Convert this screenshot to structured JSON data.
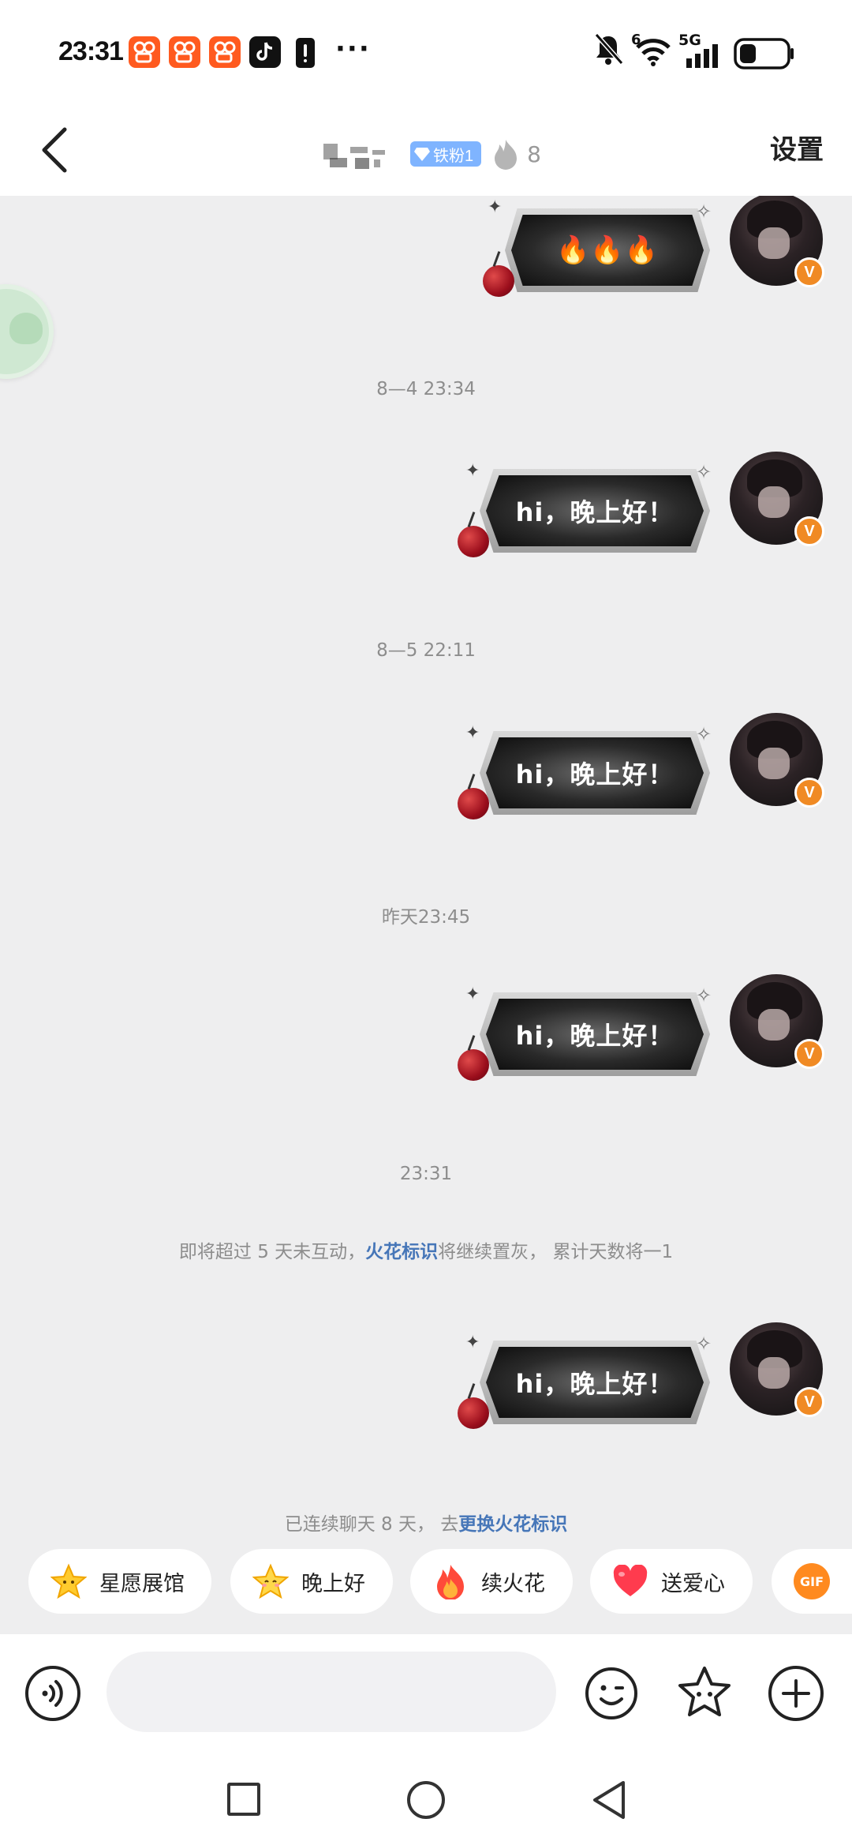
{
  "status_bar": {
    "time": "23:31",
    "network": "5G",
    "wifi_level": "6",
    "icons": [
      "kuaishou-icon",
      "kuaishou-icon",
      "kuaishou-icon",
      "douyin-icon",
      "battery-alert-icon",
      "more-icon",
      "mute-icon",
      "wifi-icon",
      "signal-icon",
      "battery-icon"
    ]
  },
  "header": {
    "fan_badge": "铁粉1",
    "spark_count": "8",
    "settings_label": "设置"
  },
  "messages": [
    {
      "kind": "sticker",
      "text": "🔥🔥🔥"
    },
    {
      "kind": "timestamp",
      "text": "8—4  23:34"
    },
    {
      "kind": "bubble",
      "text": "hi，晚上好！"
    },
    {
      "kind": "timestamp",
      "text": "8—5  22:11"
    },
    {
      "kind": "bubble",
      "text": "hi，晚上好！"
    },
    {
      "kind": "timestamp",
      "text": "昨天23:45"
    },
    {
      "kind": "bubble",
      "text": "hi，晚上好！"
    },
    {
      "kind": "timestamp",
      "text": "23:31"
    },
    {
      "kind": "bubble",
      "text": "hi，晚上好！"
    }
  ],
  "notice_warning": {
    "prefix": "即将超过 5 天未互动，",
    "link": "火花标识",
    "suffix": "将继续置灰，  累计天数将一1"
  },
  "notice_streak": {
    "prefix": "已连续聊天 8 天，  去",
    "link": "更换火花标识"
  },
  "avatar_badge": "V",
  "quick_chips": [
    {
      "label": "星愿展馆",
      "icon": "star-icon"
    },
    {
      "label": "晚上好",
      "icon": "star-face-icon"
    },
    {
      "label": "续火花",
      "icon": "flame-icon"
    },
    {
      "label": "送爱心",
      "icon": "heart-icon"
    },
    {
      "label": "GIF",
      "icon": "gif-icon"
    }
  ],
  "input": {
    "placeholder": ""
  },
  "colors": {
    "accent_link": "#4676b8",
    "badge_orange": "#f08a24",
    "fan_badge_blue": "#7fb4ff",
    "chat_bg": "#eeeeef"
  }
}
